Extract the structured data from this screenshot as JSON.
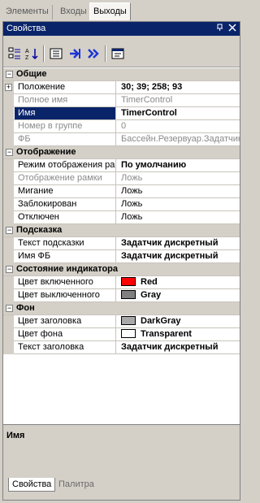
{
  "top_tabs": [
    "Элементы",
    "Входы",
    "Выходы"
  ],
  "panel": {
    "title": "Свойства",
    "pin_icon": "pin-icon",
    "close_icon": "close-icon"
  },
  "toolbar": {
    "buttons": [
      "categorized-icon",
      "alphabetical-icon",
      "properties-icon",
      "events-icon",
      "methods-icon",
      "property-pages-icon"
    ]
  },
  "grid": {
    "categories": {
      "general": "Общие",
      "display": "Отображение",
      "tooltip": "Подсказка",
      "indicator": "Состояние индикатора",
      "background": "Фон"
    },
    "general": [
      {
        "name": "Положение",
        "value": "30; 39; 258; 93"
      },
      {
        "name": "Полное имя",
        "value": "TimerControl"
      },
      {
        "name": "Имя",
        "value": "TimerControl"
      },
      {
        "name": "Номер в группе",
        "value": "0"
      },
      {
        "name": "ФБ",
        "value": "Бассейн.Резервуар.Задатчик"
      }
    ],
    "display": [
      {
        "name": "Режим отображения ра",
        "value": "По умолчанию"
      },
      {
        "name": "Отображение рамки",
        "value": "Ложь"
      },
      {
        "name": "Мигание",
        "value": "Ложь"
      },
      {
        "name": "Заблокирован",
        "value": "Ложь"
      },
      {
        "name": "Отключен",
        "value": "Ложь"
      }
    ],
    "tooltip": [
      {
        "name": "Текст подсказки",
        "value": "Задатчик дискретный"
      },
      {
        "name": "Имя ФБ",
        "value": "Задатчик дискретный"
      }
    ],
    "indicator": [
      {
        "name": "Цвет включенного",
        "value": "Red",
        "color": "#ff0000"
      },
      {
        "name": "Цвет выключенного",
        "value": "Gray",
        "color": "#808080"
      }
    ],
    "background": [
      {
        "name": "Цвет заголовка",
        "value": "DarkGray",
        "color": "#a9a9a9"
      },
      {
        "name": "Цвет фона",
        "value": "Transparent",
        "color": "#ffffff"
      },
      {
        "name": "Текст заголовка",
        "value": "Задатчик дискретный"
      }
    ]
  },
  "description": {
    "title": "Имя"
  },
  "bottom_tabs": [
    "Свойства",
    "Палитра"
  ]
}
